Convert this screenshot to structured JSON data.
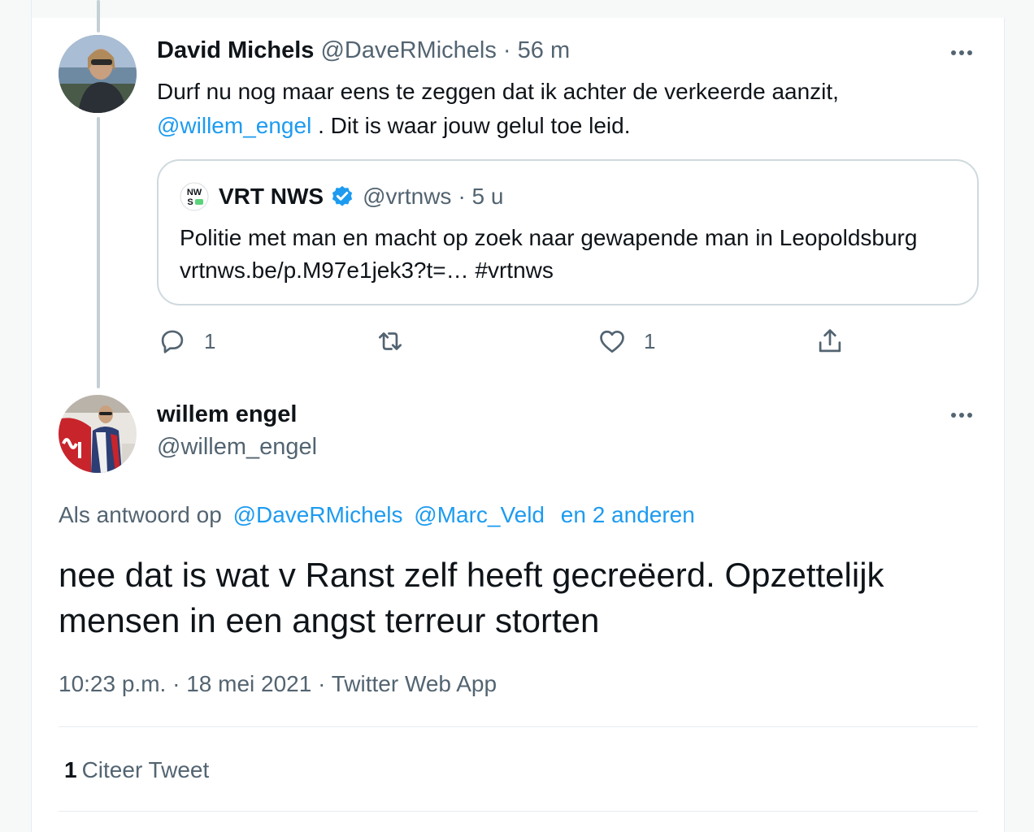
{
  "parent_tweet": {
    "author_name": "David Michels",
    "author_handle": "@DaveRMichels",
    "time": "· 56 m",
    "text_before_mention": "Durf nu nog maar eens te zeggen dat ik achter de verkeerde aanzit,",
    "mention": "@willem_engel",
    "text_after_mention": ". Dit is waar jouw gelul toe leid.",
    "quoted_tweet": {
      "logo_text_top": "NW",
      "logo_text_bottom": "S",
      "author_name": "VRT NWS",
      "author_handle": "@vrtnws",
      "time": "· 5 u",
      "text": "Politie met man en macht op zoek naar gewapende man in Leopoldsburg vrtnws.be/p.M97e1jek3?t=… #vrtnws"
    },
    "actions": {
      "reply_count": "1",
      "retweet_count": "",
      "like_count": "1"
    }
  },
  "main_tweet": {
    "author_name": "willem engel",
    "author_handle": "@willem_engel",
    "reply_prefix": "Als antwoord op",
    "reply_mention_1": "@DaveRMichels",
    "reply_mention_2": "@Marc_Veld",
    "reply_others": "en 2 anderen",
    "text": "nee dat is wat v Ranst zelf heeft gecreëerd. Opzettelijk mensen in een angst terreur storten",
    "time": "10:23 p.m.",
    "date": "· 18 mei 2021 ·",
    "source": "Twitter Web App",
    "quote_count": "1",
    "quote_label": "Citeer Tweet"
  },
  "icons": {
    "more": "more-icon",
    "reply": "reply-icon",
    "retweet": "retweet-icon",
    "like": "heart-icon",
    "share": "share-icon",
    "verified": "verified-badge-icon"
  },
  "colors": {
    "link": "#1d9bf0",
    "secondary_text": "#536471",
    "primary_text": "#0f1419",
    "border": "#cfd9de",
    "thread_line": "#c4cfd6"
  }
}
